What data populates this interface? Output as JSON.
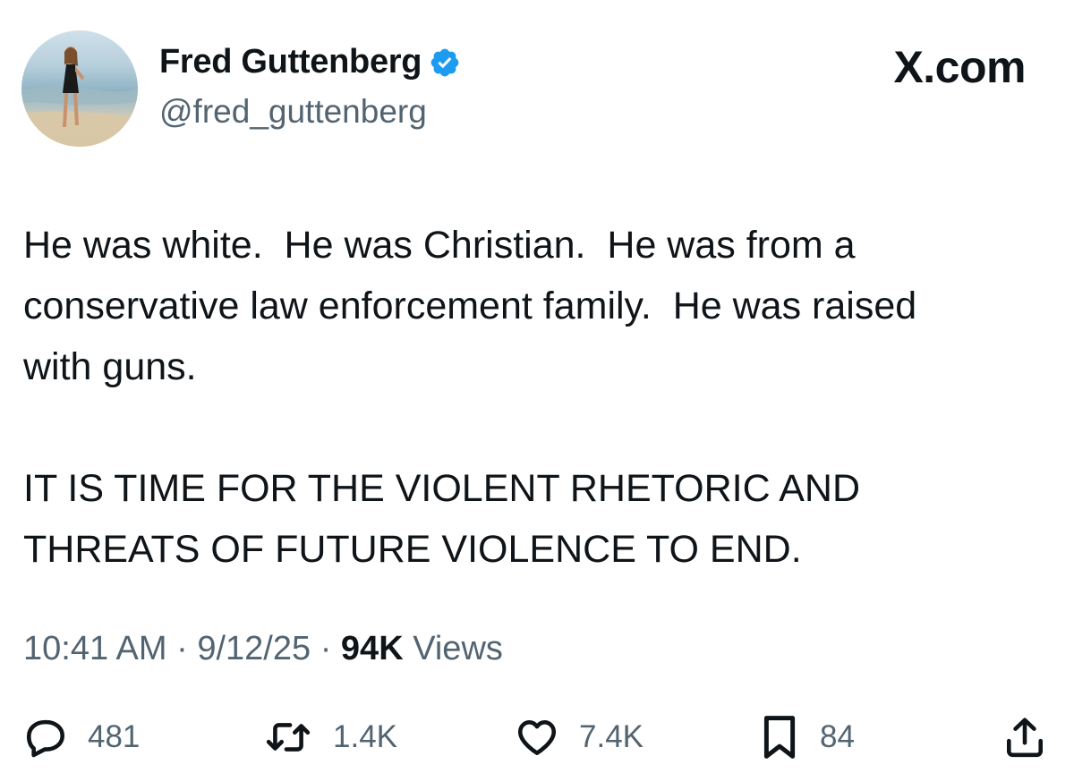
{
  "author": {
    "display_name": "Fred Guttenberg",
    "handle": "@fred_guttenberg",
    "verified_icon": "verified-badge-icon",
    "verified_color": "#1d9bf0"
  },
  "brand": {
    "label": "X.com"
  },
  "tweet": {
    "paragraphs": [
      "He was white.  He was Christian.  He was from a\nconservative law enforcement family.  He was raised\nwith guns.",
      "IT IS TIME FOR THE VIOLENT RHETORIC AND\nTHREATS OF FUTURE VIOLENCE TO END."
    ]
  },
  "meta": {
    "time": "10:41 AM",
    "separator": "·",
    "date": "9/12/25",
    "views_count": "94K",
    "views_label": "Views"
  },
  "actions": {
    "reply": {
      "icon": "reply-icon",
      "count": "481"
    },
    "repost": {
      "icon": "repost-icon",
      "count": "1.4K"
    },
    "like": {
      "icon": "heart-icon",
      "count": "7.4K"
    },
    "bookmark": {
      "icon": "bookmark-icon",
      "count": "84"
    },
    "share": {
      "icon": "share-icon"
    }
  },
  "colors": {
    "text_primary": "#0f1419",
    "text_secondary": "#536471",
    "accent": "#1d9bf0"
  }
}
